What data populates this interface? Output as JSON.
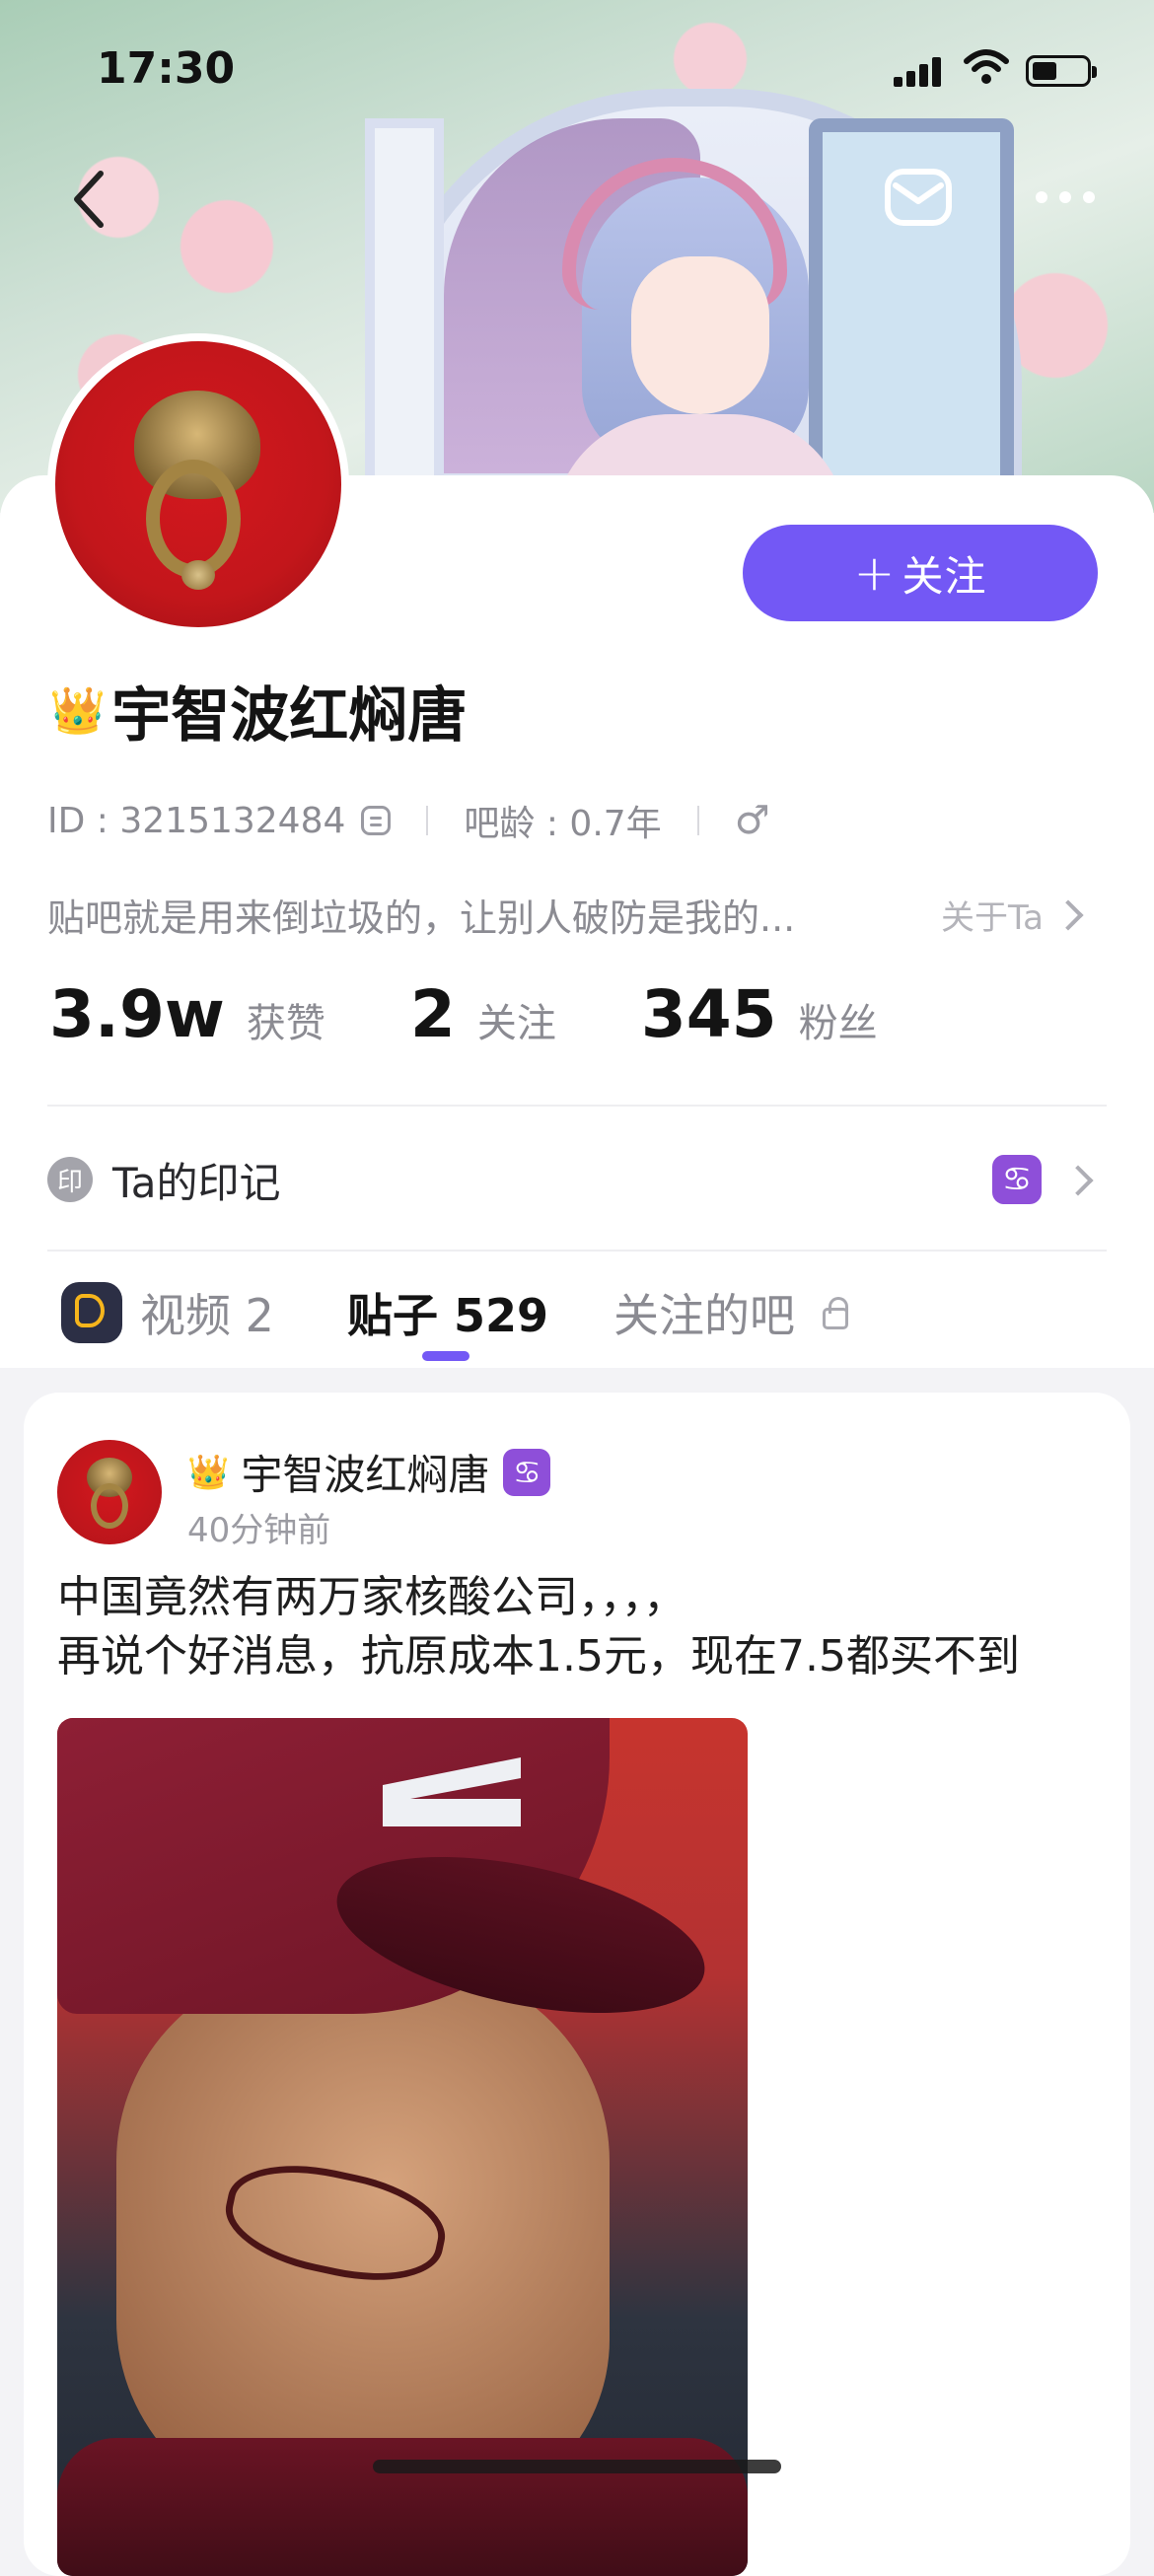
{
  "status": {
    "time": "17:30"
  },
  "nav": {
    "back_icon": "chevron-left-icon",
    "mail_icon": "envelope-icon",
    "more_icon": "ellipsis-icon"
  },
  "profile": {
    "follow_plus": "+",
    "follow_label": "关注",
    "crown": "👑",
    "name": "宇智波红焖唐",
    "id_text": "ID : 3215132484",
    "age_text": "吧龄 : 0.7年",
    "gender_symbol": "♂",
    "bio": "贴吧就是用来倒垃圾的，让别人破防是我的...",
    "about_label": "关于Ta",
    "stats": [
      {
        "value": "3.9w",
        "label": "获赞"
      },
      {
        "value": "2",
        "label": "关注"
      },
      {
        "value": "345",
        "label": "粉丝"
      }
    ],
    "mark_icon_text": "印",
    "mark_label": "Ta的印记",
    "zodiac_badge": "♋"
  },
  "tabs": [
    {
      "label": "视频 2"
    },
    {
      "label": "贴子 529"
    },
    {
      "label": "关注的吧"
    }
  ],
  "post": {
    "crown": "👑",
    "author": "宇智波红焖唐",
    "zodiac_badge": "♋",
    "time": "40分钟前",
    "line1": "中国竟然有两万家核酸公司，，，，",
    "line2": "再说个好消息，抗原成本1.5元，现在7.5都买不到"
  },
  "colors": {
    "accent": "#7358f5",
    "badge": "#8e4fd9"
  }
}
